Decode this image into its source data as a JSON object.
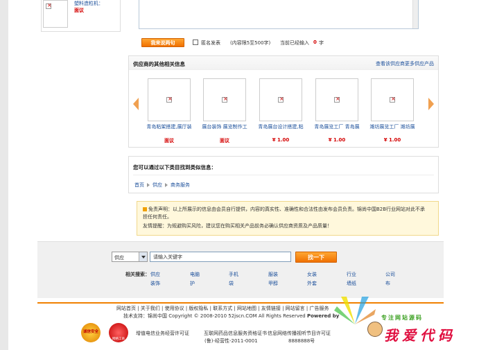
{
  "top_product": {
    "name": "塑料造粒机：",
    "price": "面议"
  },
  "review_form": {
    "submit_label": "我来说两句",
    "anonymous_label": "匿名发表",
    "length_hint": "(内容限5至500字)",
    "count_prefix": "当前已经输入",
    "count_value": "0",
    "count_suffix": "字"
  },
  "supplier_panel": {
    "title": "供应商的其他相关信息",
    "more_link": "查看该供应商更多供应产品",
    "products": [
      {
        "name": "青岛粘架搭建,展厅装",
        "price": "面议"
      },
      {
        "name": "展台装饰 展览制作工",
        "price": "面议"
      },
      {
        "name": "青岛展台设计搭建,粘",
        "price": "¥ 1.00"
      },
      {
        "name": "青岛展览工厂 青岛展",
        "price": "¥ 1.00"
      },
      {
        "name": "潍坊展览工厂 潍坊展",
        "price": "¥ 1.00"
      }
    ]
  },
  "category_panel": {
    "title": "您可以通过以下类目找到类似信息：",
    "breadcrumb": [
      "首页",
      "供应",
      "商务服务"
    ]
  },
  "notice": {
    "line1": "免责声明：以上所展示的信息由会员自行提供，内容的真实性、准确性和合法性由发布会员负责。锦尚中国B2B行业网站对此不承",
    "line2": "担任何责任。",
    "line3": "友情提醒：为规避购买风险，建议您在购买相关产品前务必确认供应商资质及产品质量！"
  },
  "search": {
    "type_selected": "供应",
    "input_value": "请输入关键字",
    "button_label": "找一下",
    "related_label": "相关搜索：",
    "keywords_row1": [
      "供应",
      "电脑",
      "手机",
      "服装",
      "女装",
      "行业",
      "公司"
    ],
    "keywords_row2": [
      "装饰",
      "护",
      "袋",
      "甲醇",
      "外套",
      "墙纸",
      "布"
    ]
  },
  "footer": {
    "links": "网站首页 | 关于我们 | 使用协议 | 版权隐私 | 联系方式 | 网站地图 | 友情链接 | 网站留言 | 广告服务",
    "copyright_prefix": "技术支持：锦尚中国 Copyright © 2008-2010  52jscn.COM All Rights Reserved",
    "powered_by": "Powered by",
    "license1": "增值电信业务经营许可证",
    "license2a": "互联网药品信息服务资格证书",
    "license2b": "(鲁)-经营性-2011-0001",
    "license3a": "信息网络传播视听节目许可证",
    "license3b": "8888888号"
  },
  "badges": {
    "badge1": "诚信安全",
    "badge2": "网络工商"
  },
  "watermark": {
    "small": "专注网站源码",
    "big": "我爱代码"
  },
  "colors": {
    "accent_orange": "#f07000",
    "link_blue": "#1a4e9a",
    "price_red": "#d40000"
  }
}
